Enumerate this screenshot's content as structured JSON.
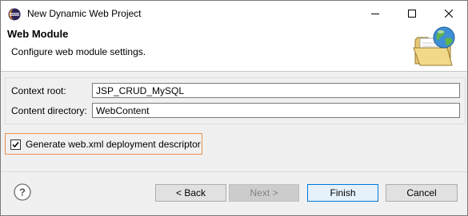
{
  "window": {
    "title": "New Dynamic Web Project",
    "icons": {
      "app": "eclipse-icon",
      "minimize": "minimize-icon",
      "maximize": "maximize-icon",
      "close": "close-icon"
    }
  },
  "header": {
    "title": "Web Module",
    "description": "Configure web module settings.",
    "image": "web-folder-globe-icon"
  },
  "form": {
    "context_root": {
      "label": "Context root:",
      "value": "JSP_CRUD_MySQL"
    },
    "content_directory": {
      "label": "Content directory:",
      "value": "WebContent"
    },
    "generate_descriptor": {
      "label": "Generate web.xml deployment descriptor",
      "checked": true
    }
  },
  "buttons": {
    "help_icon": "help-icon",
    "back": "< Back",
    "next": "Next >",
    "finish": "Finish",
    "cancel": "Cancel"
  },
  "colors": {
    "highlight_border": "#e9914e",
    "default_button_border": "#0078d7",
    "dialog_bg": "#f0f0f0"
  }
}
